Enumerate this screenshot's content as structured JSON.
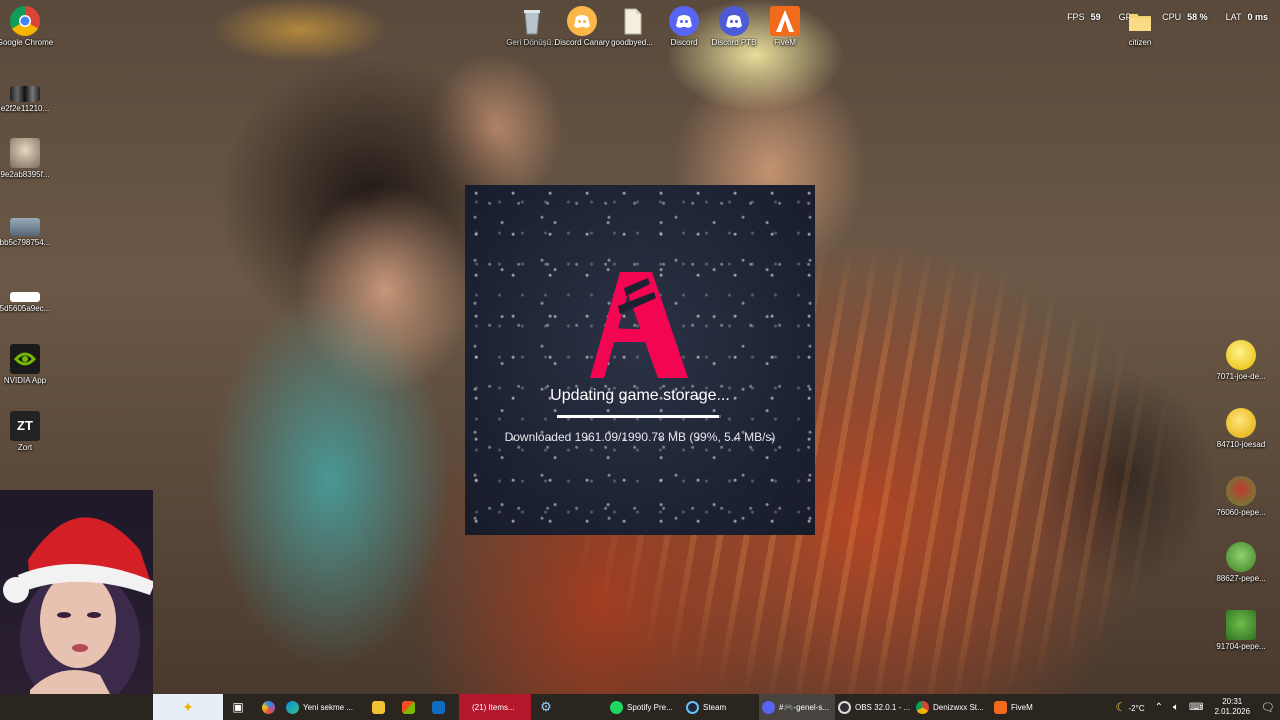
{
  "overlay": {
    "fps_label": "FPS",
    "fps_value": "59",
    "gpu_label": "GPU",
    "gpu_value": "",
    "cpu_label": "CPU",
    "cpu_value": "58 %",
    "lat_label": "LAT",
    "lat_value": "0 ms"
  },
  "desktop_left": [
    {
      "label": "Google Chrome",
      "icon": "chrome-icon"
    },
    {
      "label": "e2f2e11210...",
      "icon": "image-file-icon"
    },
    {
      "label": "9e2ab8395f...",
      "icon": "image-file-icon"
    },
    {
      "label": "bb5c798754...",
      "icon": "image-file-icon"
    },
    {
      "label": "5d5605a9ec...",
      "icon": "image-file-icon"
    },
    {
      "label": "NVIDIA App",
      "icon": "nvidia-icon"
    },
    {
      "label": "Zort",
      "icon": "zort-icon"
    }
  ],
  "desktop_top": [
    {
      "label": "Geri Dönüşü...",
      "icon": "recycle-bin-icon"
    },
    {
      "label": "Discord Canary",
      "icon": "discord-canary-icon"
    },
    {
      "label": "goodbyed...",
      "icon": "file-icon"
    },
    {
      "label": "Discord",
      "icon": "discord-icon"
    },
    {
      "label": "Discord PTB",
      "icon": "discord-ptb-icon"
    },
    {
      "label": "FiveM",
      "icon": "fivem-icon"
    }
  ],
  "desktop_top_right": {
    "label": "citizen",
    "icon": "folder-icon"
  },
  "desktop_right": [
    {
      "label": "7071-joe-de...",
      "icon": "emoji-image-icon"
    },
    {
      "label": "84710-joesad",
      "icon": "emoji-image-icon"
    },
    {
      "label": "76060-pepe...",
      "icon": "emoji-image-icon"
    },
    {
      "label": "88627-pepe...",
      "icon": "emoji-image-icon"
    },
    {
      "label": "91704-pepe...",
      "icon": "emoji-image-icon"
    }
  ],
  "loader": {
    "status": "Updating game storage...",
    "progress_fraction": 0.99,
    "download_text": "Downloaded 1961.09/1990.78 MB (99%, 5.4 MB/s)"
  },
  "taskbar": {
    "items": [
      {
        "label": "",
        "icon": "copilot-sparkle-icon"
      },
      {
        "label": "",
        "icon": "task-view-icon"
      },
      {
        "label": "",
        "icon": "copilot-icon"
      },
      {
        "label": "Yeni sekme ...",
        "icon": "edge-icon"
      },
      {
        "label": "",
        "icon": "file-explorer-icon"
      },
      {
        "label": "",
        "icon": "store-icon"
      },
      {
        "label": "",
        "icon": "mail-icon"
      },
      {
        "label": "(21) Items...",
        "icon": "item-icon"
      },
      {
        "label": "",
        "icon": "settings-app-icon"
      },
      {
        "label": "Spotify Pre...",
        "icon": "spotify-icon"
      },
      {
        "label": "Steam",
        "icon": "steam-icon"
      },
      {
        "label": "#🎮-genel-s...",
        "icon": "discord-icon"
      },
      {
        "label": "OBS 32.0.1 - ...",
        "icon": "obs-icon"
      },
      {
        "label": "Denizwxx St...",
        "icon": "chrome-icon"
      },
      {
        "label": "FiveM",
        "icon": "fivem-icon"
      }
    ],
    "weather": "-2°C",
    "time": "20:31",
    "date": "2.01.2026"
  },
  "colors": {
    "fivem_red": "#f40552",
    "taskbar_bg": "#2b2520",
    "loader_bg": "#1c2132"
  }
}
